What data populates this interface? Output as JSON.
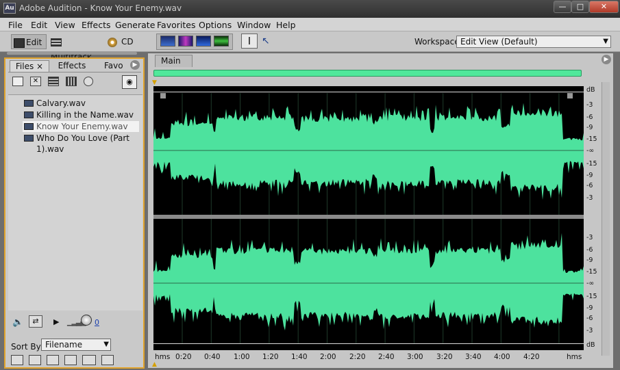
{
  "window": {
    "app_icon": "Au",
    "title": "Adobe Audition - Know Your Enemy.wav",
    "minimize": "—",
    "maximize": "□",
    "close": "✕"
  },
  "menu": [
    "File",
    "Edit",
    "View",
    "Effects",
    "Generate",
    "Favorites",
    "Options",
    "Window",
    "Help"
  ],
  "toolbar": {
    "edit_label": "Edit",
    "multitrack_label": "Multitrack",
    "cd_label": "CD",
    "workspace_label": "Workspace:",
    "workspace_value": "Edit View (Default)"
  },
  "left_panel": {
    "tabs": {
      "files": "Files",
      "effects": "Effects",
      "favorites": "Favo"
    },
    "files": [
      "Calvary.wav",
      "Killing in the Name.wav",
      "Know Your Enemy.wav",
      "Who Do You Love (Part 1).wav"
    ],
    "selected_index": 2,
    "volume_value": "0",
    "sort_label": "Sort By:",
    "sort_value": "Filename"
  },
  "main": {
    "tab": "Main",
    "ruler_top": [
      "dB",
      "-3",
      "-6",
      "-9",
      "-15",
      "-∞",
      "-15",
      "-9",
      "-6",
      "-3"
    ],
    "ruler_bottom": [
      "-3",
      "-6",
      "-9",
      "-15",
      "-∞",
      "-15",
      "-9",
      "-6",
      "-3",
      "dB"
    ],
    "timeline": [
      "hms",
      "0:20",
      "0:40",
      "1:00",
      "1:20",
      "1:40",
      "2:00",
      "2:20",
      "2:40",
      "3:00",
      "3:20",
      "3:40",
      "4:00",
      "4:20",
      "hms"
    ]
  },
  "colors": {
    "accent": "#e1a32b",
    "waveform": "#4de29e",
    "wave_bg": "#000000"
  }
}
